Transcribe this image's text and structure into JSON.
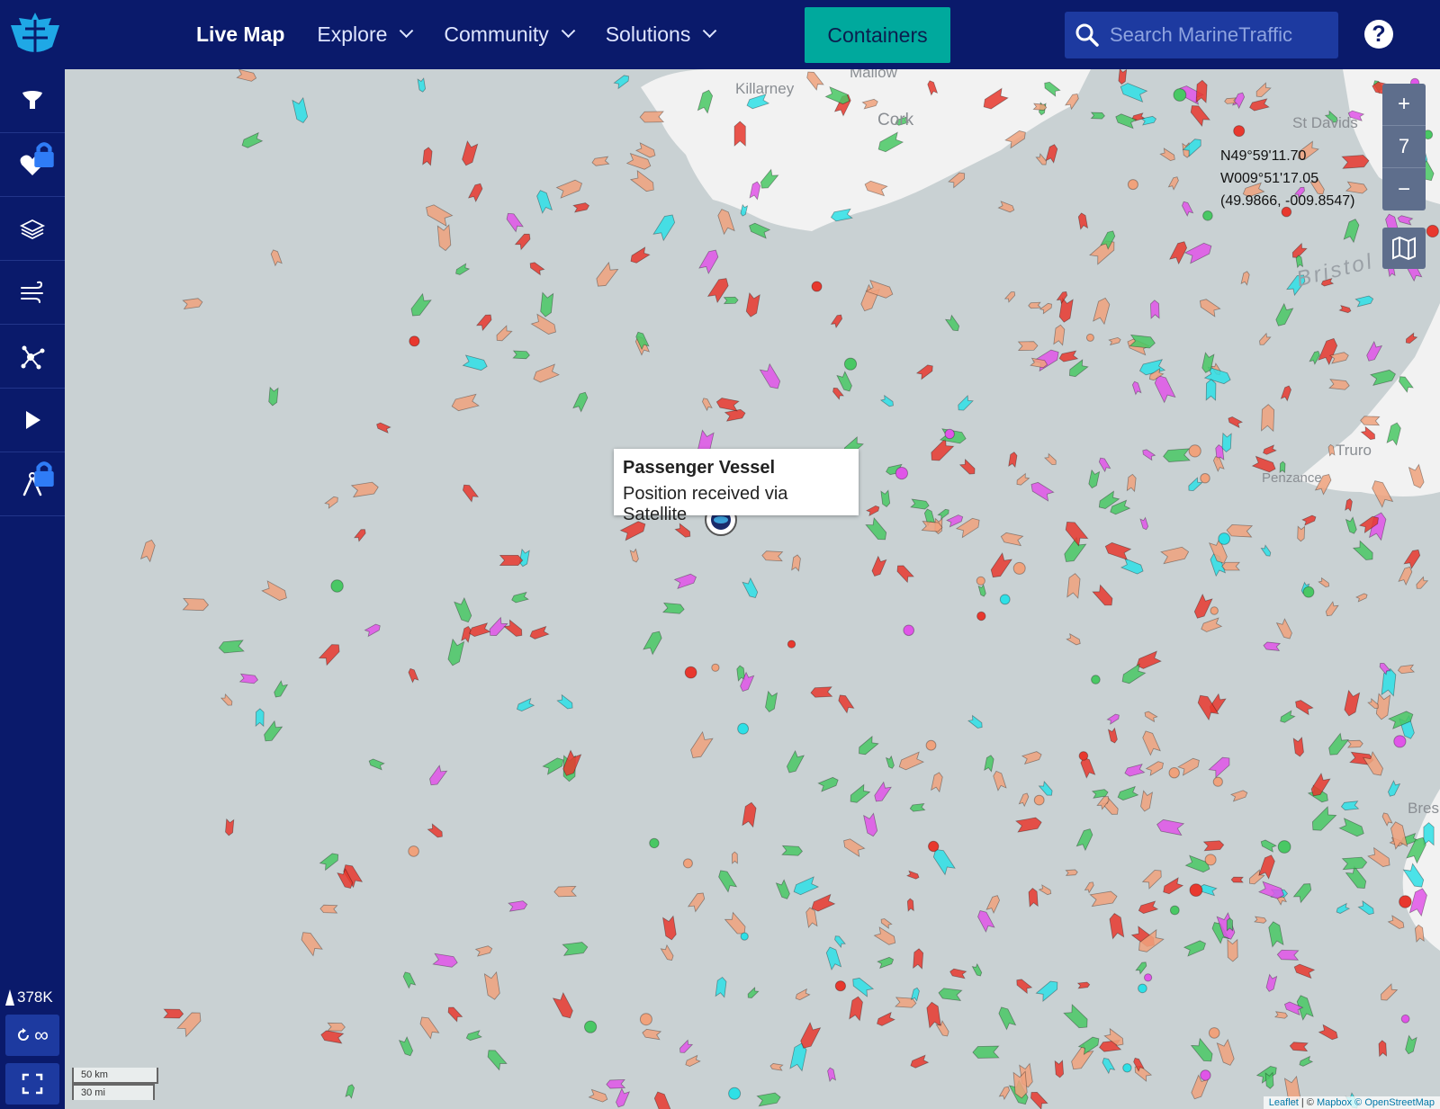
{
  "nav": {
    "live_map": "Live Map",
    "explore": "Explore",
    "community": "Community",
    "solutions": "Solutions",
    "containers": "Containers",
    "search_placeholder": "Search MarineTraffic",
    "help": "?"
  },
  "sidebar": {
    "items": [
      "filter-icon",
      "favorites-icon",
      "layers-icon",
      "weather-icon",
      "network-icon",
      "play-icon",
      "measure-icon"
    ],
    "vessel_count": "378K",
    "loop_label": "∞"
  },
  "map": {
    "zoom_in": "+",
    "zoom_level": "7",
    "zoom_out": "−",
    "coords": {
      "lat": "N49°59'11.70",
      "lon": "W009°51'17.05",
      "decimal": "(49.9866, -009.8547)"
    },
    "places": {
      "mallow": "Mallow",
      "killarney": "Killarney",
      "cork": "Cork",
      "st_davids": "St Davids",
      "bristol": "Bristol",
      "truro": "Truro",
      "penzance": "Penzance",
      "brest": "Bres"
    },
    "tooltip": {
      "title": "Passenger Vessel",
      "subtitle": "Position received via Satellite"
    },
    "scale": {
      "km": "50 km",
      "mi": "30 mi"
    },
    "attribution": {
      "leaflet": "Leaflet",
      "rest": "| © ",
      "mapbox": "Mapbox",
      "osm": "© OpenStreetMap"
    },
    "colors": {
      "sea": "#c9d1d3",
      "land": "#f2f2f2",
      "cargo": "#49c864",
      "tanker": "#e8382e",
      "fishing": "#f0a27c",
      "passenger": "#3b5bd6",
      "pleasure": "#e055e8",
      "tug": "#2ee0e6"
    }
  }
}
